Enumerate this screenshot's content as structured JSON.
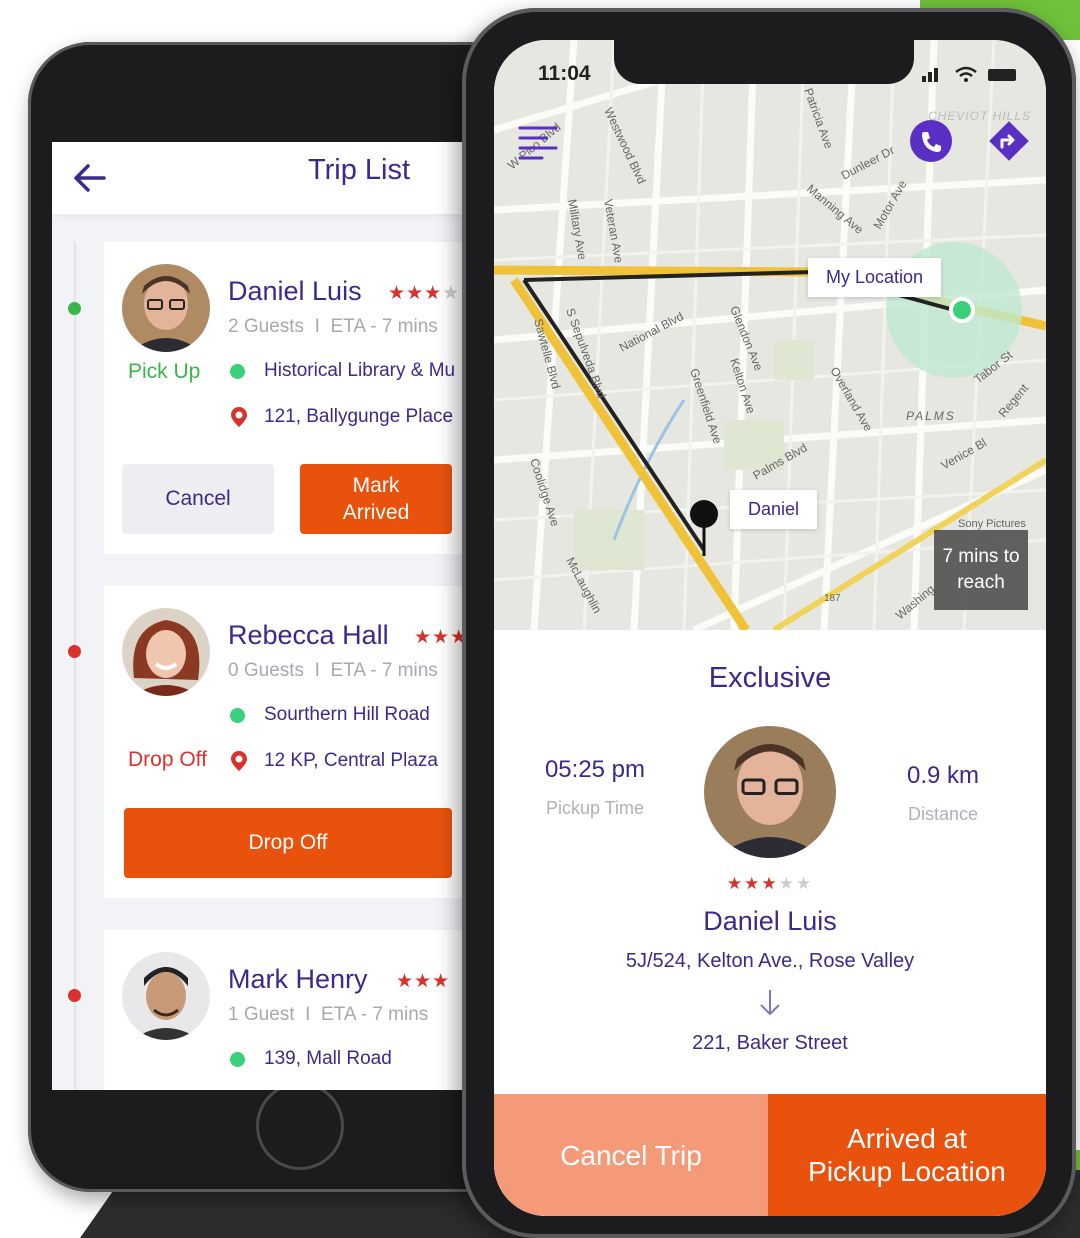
{
  "colors": {
    "accent": "#3a2a8c",
    "orange": "#e8520c",
    "green": "#3ad07a",
    "red": "#d9312b",
    "cancel_light": "#f38a64",
    "cancel_trip": "#f49a78"
  },
  "trip_list": {
    "title": "Trip List",
    "back_icon": "arrow-left-icon",
    "trips": [
      {
        "name": "Daniel Luis",
        "guests": "2 Guests",
        "eta": "ETA - 7 mins",
        "status": "Pick Up",
        "pickup": "Historical Library & Mu",
        "drop": "121, Ballygunge Place",
        "rating": 3,
        "cancel_label": "Cancel",
        "primary_label": "Mark Arrived"
      },
      {
        "name": "Rebecca Hall",
        "guests": "0 Guests",
        "eta": "ETA - 7 mins",
        "status": "Drop Off",
        "pickup": "Sourthern Hill Road",
        "drop": "12 KP, Central Plaza",
        "rating": 3,
        "primary_label": "Drop Off"
      },
      {
        "name": "Mark Henry",
        "guests": "1 Guest",
        "eta": "ETA - 7 mins",
        "pickup": "139, Mall Road",
        "rating": 3
      }
    ],
    "separator": "I"
  },
  "driver_screen": {
    "status_time": "11:04",
    "map": {
      "my_location_label": "My Location",
      "rider_label": "Daniel",
      "eta_label": "7 mins to reach",
      "call_icon": "phone-icon",
      "directions_icon": "directions-icon",
      "menu_icon": "hamburger-menu-icon",
      "streets": [
        "W Pico Blvd",
        "Westwood Blvd",
        "National Blvd",
        "Palms Blvd",
        "S Sepulveda Blvd",
        "Sawtelle Blvd",
        "Overland Ave",
        "Motor Ave",
        "Venice Bl",
        "PALMS",
        "CHEVIOT HILLS",
        "Sony Pictures",
        "Military Ave",
        "Veteran Ave",
        "Kelton Ave",
        "Greenfield Ave",
        "Glendon Ave",
        "Coolidge Ave",
        "McLaughlin",
        "Tabor St",
        "Regent",
        "Dunleer Dr",
        "Manning Ave",
        "Patricia Ave",
        "Washing",
        "187"
      ]
    },
    "panel": {
      "title": "Exclusive",
      "pickup_time": "05:25 pm",
      "pickup_time_label": "Pickup Time",
      "distance": "0.9 km",
      "distance_label": "Distance",
      "rating": 3,
      "rider_name": "Daniel Luis",
      "from_address": "5J/524, Kelton Ave., Rose Valley",
      "to_address": "221, Baker Street",
      "cancel_label": "Cancel Trip",
      "arrived_label": "Arrived at Pickup Location"
    }
  }
}
